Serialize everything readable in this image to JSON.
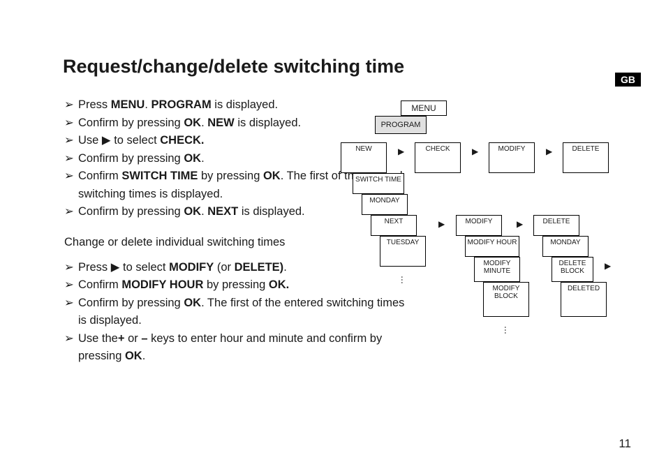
{
  "title": "Request/change/delete switching time",
  "lang_badge": "GB",
  "page_number": "11",
  "steps_a": [
    {
      "pre": "Press ",
      "b1": "MENU",
      "mid": ". ",
      "b2": "PROGRAM",
      "post": " is displayed."
    },
    {
      "pre": "Confirm by pressing ",
      "b1": "OK",
      "mid": ". ",
      "b2": "NEW",
      "post": " is displayed."
    },
    {
      "pre": "Use ▶ to select ",
      "b1": "CHECK.",
      "mid": "",
      "b2": "",
      "post": ""
    },
    {
      "pre": "Confirm by pressing ",
      "b1": "OK",
      "mid": ".",
      "b2": "",
      "post": ""
    },
    {
      "pre": "Confirm ",
      "b1": "SWITCH TIME",
      "mid": " by pressing ",
      "b2": "OK",
      "post": ". The first of the entered switching times is displayed."
    },
    {
      "pre": "Confirm by pressing ",
      "b1": "OK",
      "mid": ". ",
      "b2": "NEXT",
      "post": " is displayed."
    }
  ],
  "subhead": "Change or delete individual switching times",
  "steps_b": [
    {
      "pre": "Press ▶ to select ",
      "b1": "MODIFY",
      "mid": " (or ",
      "b2": "DELETE)",
      "post": "."
    },
    {
      "pre": "Confirm ",
      "b1": "MODIFY HOUR",
      "mid": " by pressing ",
      "b2": "OK.",
      "post": ""
    },
    {
      "pre": "Confirm by pressing ",
      "b1": "OK",
      "mid": ". The first of the entered switching times is displayed.",
      "b2": "",
      "post": ""
    },
    {
      "pre": "Use the",
      "b1": "+",
      "mid": " or ",
      "b2": "–",
      "post": " keys to enter hour and minute and confirm by pressing ",
      "b3": "OK",
      "post2": "."
    }
  ],
  "diagram": {
    "menu": "MENU",
    "program": "PROGRAM",
    "row1": {
      "new": "NEW",
      "check": "CHECK",
      "modify": "MODIFY",
      "delete": "DELETE"
    },
    "switch_time": "SWITCH TIME",
    "monday": "MONDAY",
    "next": "NEXT",
    "tuesday": "TUESDAY",
    "modify2": "MODIFY",
    "modify_hour": "MODIFY HOUR",
    "modify_minute": "MODIFY MINUTE",
    "modify_block": "MODIFY BLOCK",
    "delete2": "DELETE",
    "monday2": "MONDAY",
    "delete_block": "DELETE BLOCK",
    "deleted": "DELETED"
  }
}
